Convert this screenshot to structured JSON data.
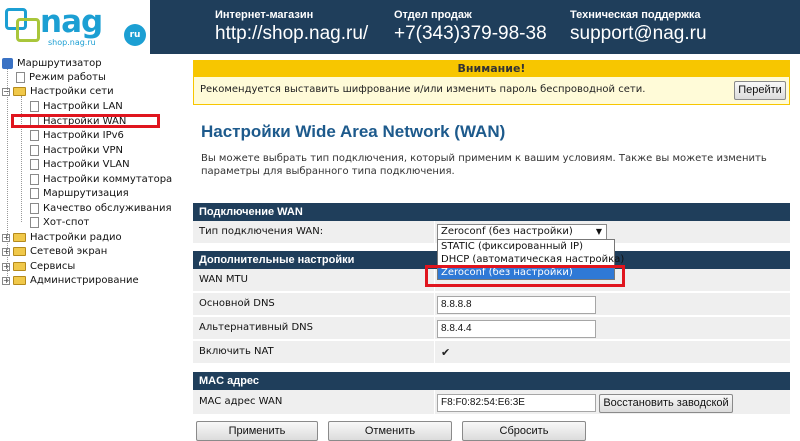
{
  "header": {
    "logo_text": "nag",
    "logo_ru": "ru",
    "logo_sub": "shop.nag.ru",
    "columns": [
      {
        "title": "Интернет-магазин",
        "value": "http://shop.nag.ru/"
      },
      {
        "title": "Отдел продаж",
        "value": "+7(343)379-98-38"
      },
      {
        "title": "Техническая поддержка",
        "value": "support@nag.ru"
      }
    ]
  },
  "sidebar": {
    "root": "Маршрутизатор",
    "items": [
      {
        "label": "Режим работы"
      },
      {
        "label": "Настройки сети"
      },
      {
        "label": "Настройки LAN"
      },
      {
        "label": "Настройки WAN"
      },
      {
        "label": "Настройки IPv6"
      },
      {
        "label": "Настройки VPN"
      },
      {
        "label": "Настройки VLAN"
      },
      {
        "label": "Настройки коммутатора"
      },
      {
        "label": "Маршрутизация"
      },
      {
        "label": "Качество обслуживания"
      },
      {
        "label": "Хот-спот"
      },
      {
        "label": "Настройки радио"
      },
      {
        "label": "Сетевой экран"
      },
      {
        "label": "Сервисы"
      },
      {
        "label": "Администрирование"
      }
    ]
  },
  "warning": {
    "title": "Внимание!",
    "text": "Рекомендуется выставить шифрование и/или изменить пароль беспроводной сети.",
    "button": "Перейти"
  },
  "page": {
    "title": "Настройки Wide Area Network (WAN)",
    "description": "Вы можете выбрать тип подключения, который применим к вашим условиям. Также вы можете изменить параметры для выбранного типа подключения."
  },
  "wan": {
    "section": "Подключение WAN",
    "type_label": "Тип подключения WAN:",
    "type_value": "Zeroconf (без настройки)",
    "options": [
      "STATIC (фиксированный IP)",
      "DHCP (автоматическая настройка)",
      "Zeroconf (без настройки)"
    ],
    "selected_index": 2
  },
  "advanced": {
    "section": "Дополнительные настройки",
    "mtu_label": "WAN MTU",
    "dns1_label": "Основной DNS",
    "dns1_value": "8.8.8.8",
    "dns2_label": "Альтернативный DNS",
    "dns2_value": "8.8.4.4",
    "nat_label": "Включить NAT",
    "nat_checked": true
  },
  "mac": {
    "section": "MAC адрес",
    "label": "MAC адрес WAN",
    "value": "F8:F0:82:54:E6:3E",
    "restore_button": "Восстановить заводской"
  },
  "actions": {
    "apply": "Применить",
    "cancel": "Отменить",
    "reset": "Сбросить"
  },
  "colors": {
    "header_bg": "#1f3e5b",
    "warning": "#f7c600",
    "title": "#1d5a8c",
    "highlight": "#e0151e",
    "selected": "#2f79d6"
  }
}
